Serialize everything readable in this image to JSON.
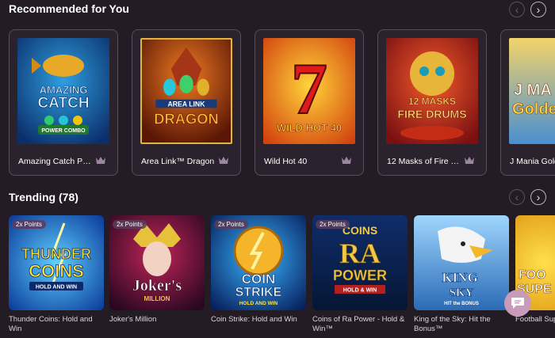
{
  "recommended": {
    "title": "Recommended for You",
    "nav": {
      "prev": "‹",
      "next": "›"
    },
    "games": [
      {
        "name": "Amazing Catch Po…",
        "art": [
          "AMAZING",
          "CATCH",
          "POWER COMBO"
        ]
      },
      {
        "name": "Area Link™ Dragon",
        "art": [
          "AREA LINK",
          "DRAGON"
        ]
      },
      {
        "name": "Wild Hot 40",
        "art": [
          "7",
          "WILD HOT 40"
        ]
      },
      {
        "name": "12 Masks of Fire D…",
        "art": [
          "12 MASKS",
          "FIRE DRUMS"
        ]
      },
      {
        "name": "J Mania Gold",
        "art": [
          "J MA",
          "Golde"
        ]
      }
    ]
  },
  "trending": {
    "title": "Trending (78)",
    "nav": {
      "prev": "‹",
      "next": "›"
    },
    "badge": "2x Points",
    "games": [
      {
        "name": "Thunder Coins: Hold and Win",
        "art": [
          "THUNDER",
          "COINS",
          "HOLD AND WIN"
        ]
      },
      {
        "name": "Joker's Million",
        "art": [
          "Joker's",
          "MILLION"
        ]
      },
      {
        "name": "Coin Strike: Hold and Win",
        "art": [
          "COIN",
          "STRIKE",
          "HOLD AND WIN"
        ]
      },
      {
        "name": "Coins of Ra Power - Hold & Win™",
        "art": [
          "COINS",
          "RA",
          "POWER",
          "HOLD & WIN"
        ]
      },
      {
        "name": "King of the Sky: Hit the Bonus™",
        "art": [
          "KING",
          "SKY",
          "HIT the BONUS"
        ]
      },
      {
        "name": "Football Sup",
        "art": [
          "FOO",
          "SUPE"
        ]
      }
    ]
  },
  "chat": {
    "icon": "chat-icon"
  }
}
